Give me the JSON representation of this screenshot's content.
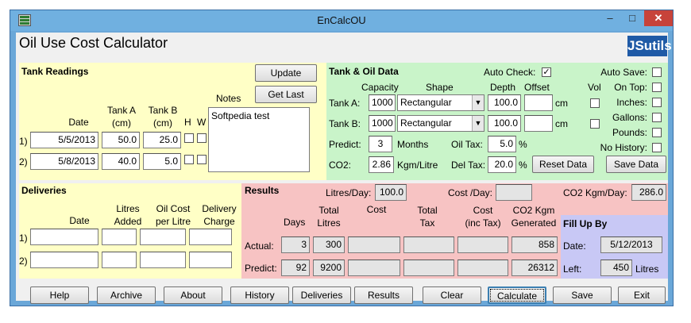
{
  "window": {
    "title": "EnCalcOU",
    "minimize": "–",
    "maximize": "□",
    "close": "✕"
  },
  "app": {
    "title": "Oil Use Cost Calculator",
    "logo": "JSutils"
  },
  "tank": {
    "heading": "Tank Readings",
    "update_btn": "Update",
    "getlast_btn": "Get Last",
    "col_date": "Date",
    "col_a": "Tank A\n(cm)",
    "col_b": "Tank B\n(cm)",
    "col_h": "H",
    "col_w": "W",
    "notes_label": "Notes",
    "notes_value": "Softpedia test",
    "rows": [
      {
        "num": "1)",
        "date": "5/5/2013",
        "a": "50.0",
        "b": "25.0"
      },
      {
        "num": "2)",
        "date": "5/8/2013",
        "a": "40.0",
        "b": "5.0"
      }
    ]
  },
  "oil": {
    "heading": "Tank & Oil Data",
    "autocheck": "Auto Check:",
    "autocheck_mark": "✓",
    "col_capacity": "Capacity",
    "col_shape": "Shape",
    "col_depth": "Depth",
    "col_offset": "Offset",
    "col_vol": "Vol",
    "tanka_label": "Tank A:",
    "tankb_label": "Tank B:",
    "tanka": {
      "capacity": "1000",
      "shape": "Rectangular",
      "depth": "100.0",
      "offset": "",
      "unit": "cm"
    },
    "tankb": {
      "capacity": "1000",
      "shape": "Rectangular",
      "depth": "100.0",
      "offset": "",
      "unit": "cm"
    },
    "predict_label": "Predict:",
    "predict_value": "3",
    "months": "Months",
    "oiltax_label": "Oil Tax:",
    "oiltax_value": "5.0",
    "pct": "%",
    "co2_label": "CO2:",
    "co2_value": "2.86",
    "co2_unit": "Kgm/Litre",
    "deltax_label": "Del Tax:",
    "deltax_value": "20.0",
    "reset_btn": "Reset Data",
    "save_btn": "Save Data",
    "options": [
      "Auto Save:",
      "On Top:",
      "Inches:",
      "Gallons:",
      "Pounds:",
      "No History:"
    ]
  },
  "deliveries": {
    "heading": "Deliveries",
    "col_date": "Date",
    "col_litres": "Litres\nAdded",
    "col_cost": "Oil Cost\nper Litre",
    "col_charge": "Delivery\nCharge",
    "rows": [
      "1)",
      "2)"
    ]
  },
  "results": {
    "heading": "Results",
    "litresday_label": "Litres/Day:",
    "litresday_value": "100.0",
    "costday_label": "Cost /Day:",
    "costday_value": "",
    "co2day_label": "CO2 Kgm/Day:",
    "co2day_value": "286.0",
    "col_days": "Days",
    "col_total_litres": "Total\nLitres",
    "col_cost": "Cost",
    "col_total_tax": "Total\nTax",
    "col_cost_inc": "Cost\n(inc Tax)",
    "col_co2": "CO2 Kgm\nGenerated",
    "actual_label": "Actual:",
    "predict_label": "Predict:",
    "actual": {
      "days": "3",
      "litres": "300",
      "co2": "858"
    },
    "predict": {
      "days": "92",
      "litres": "9200",
      "co2": "26312"
    }
  },
  "fillup": {
    "heading": "Fill Up By",
    "date_label": "Date:",
    "date_value": "5/12/2013",
    "left_label": "Left:",
    "left_value": "450",
    "left_unit": "Litres"
  },
  "buttons": [
    "Help",
    "Archive",
    "About",
    "History",
    "Deliveries",
    "Results",
    "Clear",
    "Calculate",
    "Save",
    "Exit"
  ]
}
